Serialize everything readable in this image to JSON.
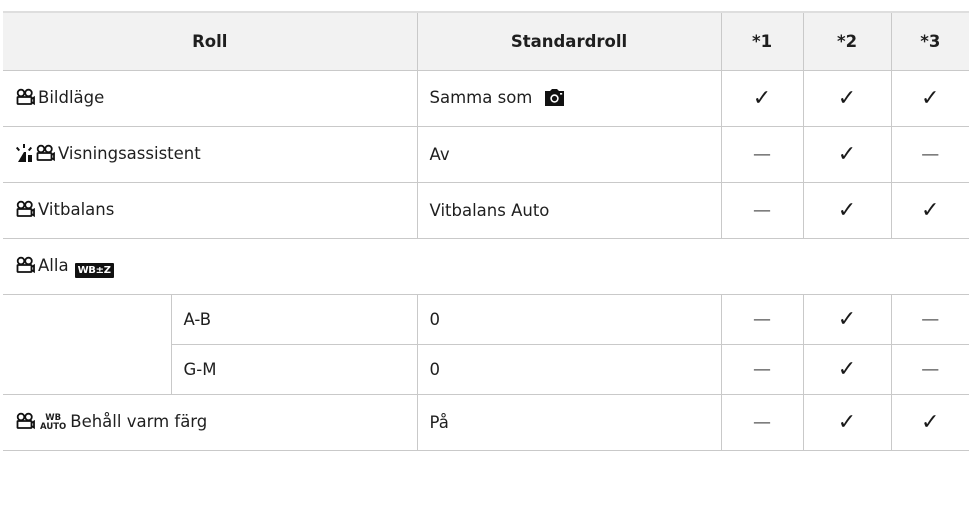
{
  "header": {
    "roll": "Roll",
    "standardroll": "Standardroll",
    "n1": "*1",
    "n2": "*2",
    "n3": "*3"
  },
  "rows": [
    {
      "label": "Bildläge",
      "standard": "Samma som",
      "m1": "✓",
      "m2": "✓",
      "m3": "✓"
    },
    {
      "label": "Visningsassistent",
      "standard": "Av",
      "m1": "—",
      "m2": "✓",
      "m3": "—"
    },
    {
      "label": "Vitbalans",
      "standard": "Vitbalans Auto",
      "m1": "—",
      "m2": "✓",
      "m3": "✓"
    },
    {
      "label": "Alla",
      "wb_badge": "WB±Z"
    },
    {
      "sub": "A-B",
      "standard": "0",
      "m1": "—",
      "m2": "✓",
      "m3": "—"
    },
    {
      "sub": "G-M",
      "standard": "0",
      "m1": "—",
      "m2": "✓",
      "m3": "—"
    },
    {
      "label": "Behåll varm färg",
      "wb_top": "WB",
      "wb_bottom": "AUTO",
      "standard": "På",
      "m1": "—",
      "m2": "✓",
      "m3": "✓"
    }
  ],
  "icons": {
    "movie": "movie-camera-icon",
    "photo": "photo-camera-icon",
    "assist": "view-assist-icon",
    "wb_comp": "wb-compensation-icon",
    "wb_auto": "wb-auto-icon"
  },
  "colors": {
    "header_bg": "#f2f2f2",
    "rule": "#c9c9c9",
    "text": "#1f1f1f"
  }
}
